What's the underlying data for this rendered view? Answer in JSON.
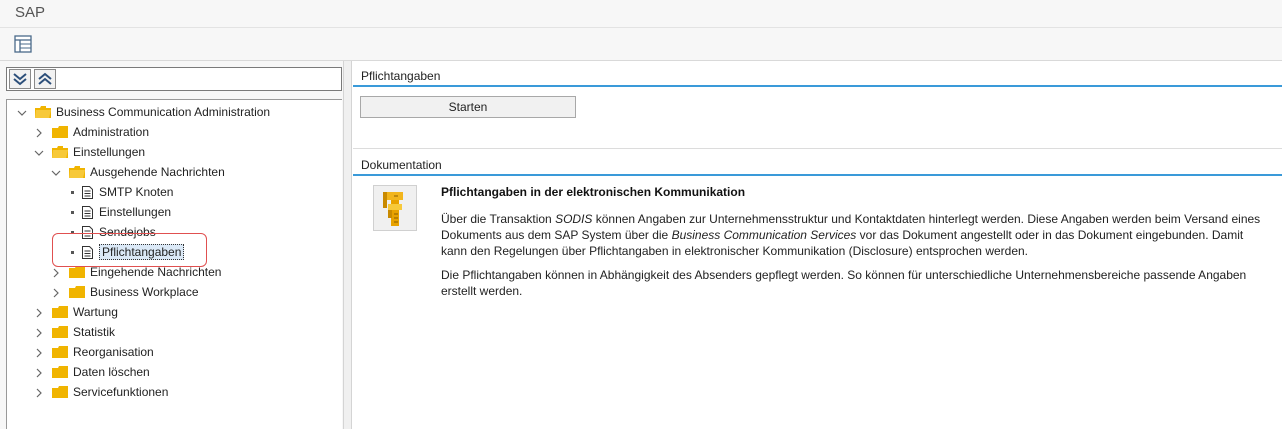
{
  "window": {
    "title": "SAP"
  },
  "toolbar": {
    "layout_icon": "table-layout-icon"
  },
  "tree_toolbar": {
    "expand_icon": "expand-all-icon",
    "collapse_icon": "collapse-all-icon"
  },
  "tree": {
    "root": "Business Communication Administration",
    "administration": "Administration",
    "einstellungen": "Einstellungen",
    "ausgehende": "Ausgehende Nachrichten",
    "smtp": "SMTP Knoten",
    "einstellungen_sub": "Einstellungen",
    "sendejobs": "Sendejobs",
    "pflichtangaben": "Pflichtangaben",
    "eingehende": "Eingehende Nachrichten",
    "workplace": "Business Workplace",
    "wartung": "Wartung",
    "statistik": "Statistik",
    "reorganisation": "Reorganisation",
    "daten_loeschen": "Daten löschen",
    "servicefunktionen": "Servicefunktionen"
  },
  "pflicht": {
    "header": "Pflichtangaben",
    "start_label": "Starten"
  },
  "doku": {
    "header": "Dokumentation",
    "title": "Pflichtangaben in der elektronischen Kommunikation",
    "p1_a": "Über die Transaktion ",
    "p1_sodis": "SODIS",
    "p1_b": " können Angaben zur Unternehmensstruktur und Kontaktdaten hinterlegt werden. Diese Angaben werden beim Versand eines Dokuments aus dem SAP System über die ",
    "p1_bcs": "Business Communication Services",
    "p1_c": " vor das Dokument angestellt oder in das Dokument eingebunden. Damit kann den Regelungen über Pflichtangaben in elektronischer Kommunikation (Disclosure) entsprochen werden.",
    "p2": "Die Pflichtangaben können in Abhängigkeit des Absenders gepflegt werden. So können für unterschiedliche Unternehmensbereiche passende Angaben erstellt werden."
  },
  "colors": {
    "accent_line": "#3a9ad9",
    "folder": "#f0b400",
    "highlight": "#e05050"
  }
}
